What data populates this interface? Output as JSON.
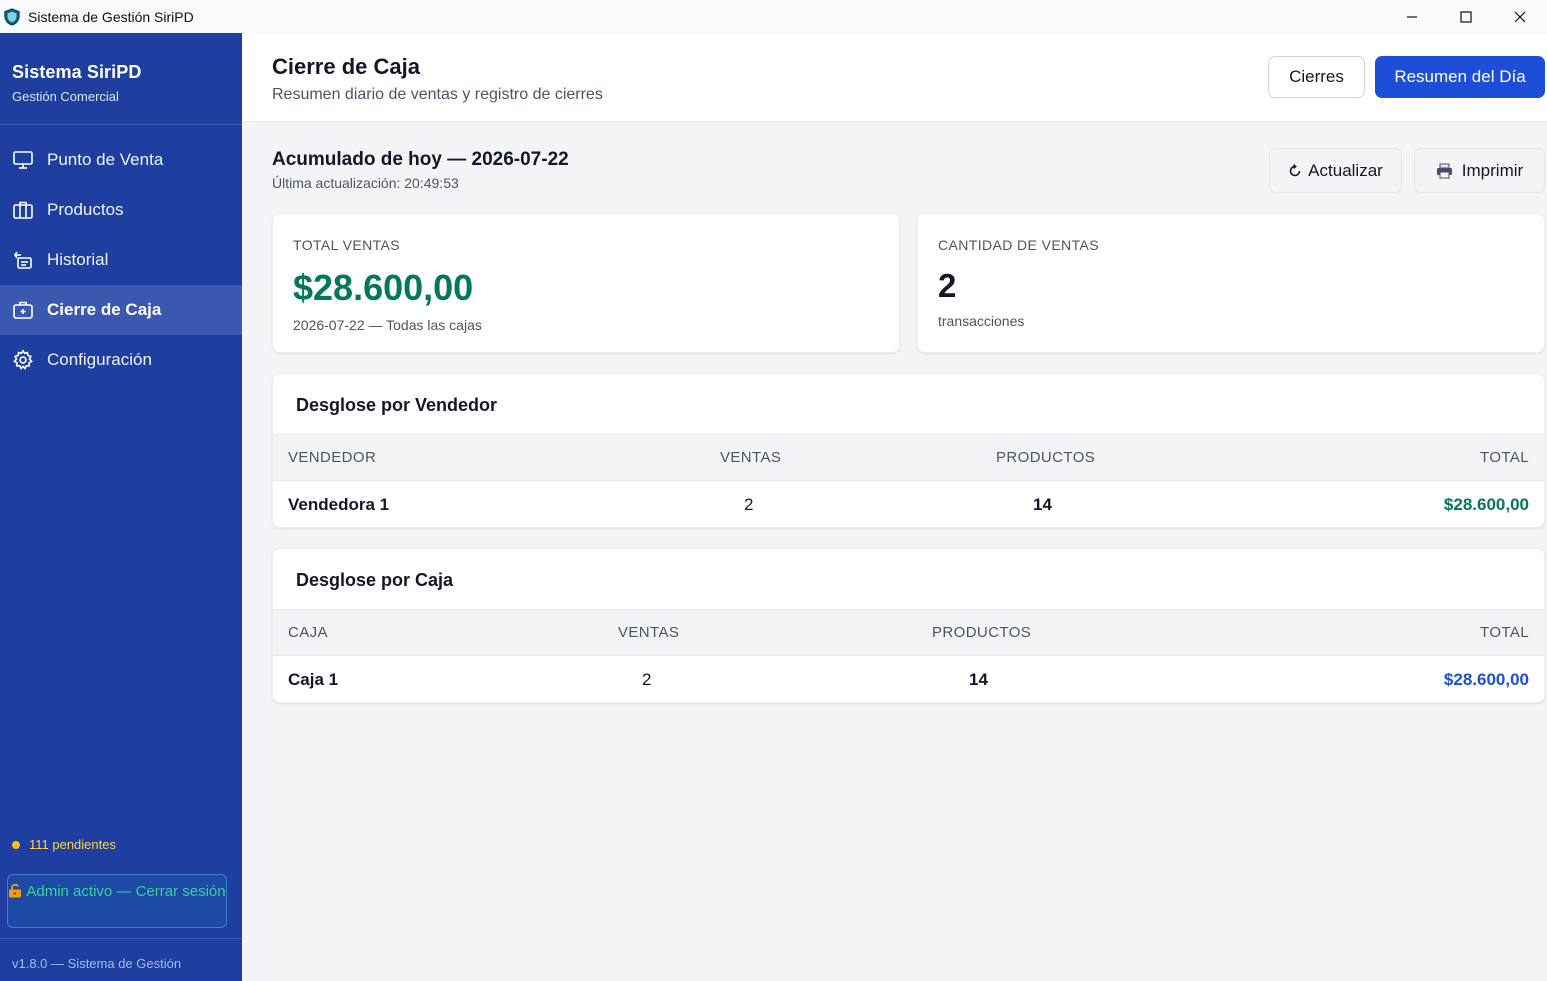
{
  "window": {
    "title": "Sistema de Gestión SiriPD"
  },
  "sidebar": {
    "brand_title": "Sistema SiriPD",
    "brand_sub": "Gestión Comercial",
    "items": [
      {
        "label": "Punto de Venta",
        "icon": "monitor-icon"
      },
      {
        "label": "Productos",
        "icon": "briefcase-icon"
      },
      {
        "label": "Historial",
        "icon": "history-icon"
      },
      {
        "label": "Cierre de Caja",
        "icon": "cash-register-icon",
        "active": true
      },
      {
        "label": "Configuración",
        "icon": "gear-icon"
      }
    ],
    "pending": "111 pendientes",
    "admin_button": "Admin activo — Cerrar sesión",
    "version": "v1.8.0 — Sistema de Gestión"
  },
  "header": {
    "title": "Cierre de Caja",
    "subtitle": "Resumen diario de ventas y registro de cierres",
    "btn_closures": "Cierres",
    "btn_summary": "Resumen del Día"
  },
  "summary": {
    "title": "Acumulado de hoy — 2026-07-22",
    "updated": "Última actualización: 20:49:53",
    "btn_refresh": "Actualizar",
    "btn_print": "Imprimir"
  },
  "stats": {
    "total_label": "TOTAL VENTAS",
    "total_value": "$28.600,00",
    "total_note": "2026-07-22 — Todas las cajas",
    "count_label": "CANTIDAD DE VENTAS",
    "count_value": "2",
    "count_note": "transacciones"
  },
  "by_seller": {
    "title": "Desglose por Vendedor",
    "columns": [
      "VENDEDOR",
      "VENTAS",
      "PRODUCTOS",
      "TOTAL"
    ],
    "rows": [
      {
        "name": "Vendedora 1",
        "sales": "2",
        "products": "14",
        "total": "$28.600,00"
      }
    ]
  },
  "by_register": {
    "title": "Desglose por Caja",
    "columns": [
      "CAJA",
      "VENTAS",
      "PRODUCTOS",
      "TOTAL"
    ],
    "rows": [
      {
        "name": "Caja 1",
        "sales": "2",
        "products": "14",
        "total": "$28.600,00"
      }
    ]
  },
  "colors": {
    "sidebar": "#1e3fa0",
    "primary": "#1d4ed8",
    "success": "#047857",
    "warning": "#fbbf24"
  }
}
